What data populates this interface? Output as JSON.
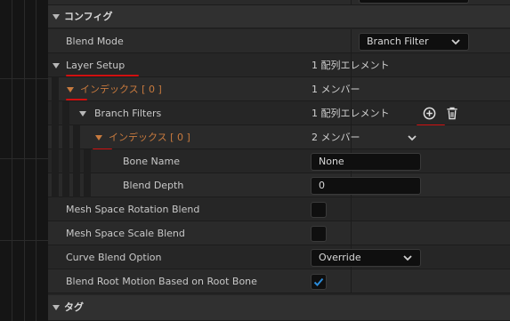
{
  "sections": {
    "config": "コンフィグ",
    "tags": "タグ"
  },
  "rows": {
    "blend_mode": {
      "label": "Blend Mode",
      "value": "Branch Filter"
    },
    "layer_setup": {
      "label": "Layer Setup",
      "value": "1 配列エレメント"
    },
    "index0": {
      "label": "インデックス [ 0 ]",
      "value": "1 メンバー"
    },
    "branch_filters": {
      "label": "Branch Filters",
      "value": "1 配列エレメント"
    },
    "index0_inner": {
      "label": "インデックス [ 0 ]",
      "value": "2 メンバー"
    },
    "bone_name": {
      "label": "Bone Name",
      "value": "None"
    },
    "blend_depth": {
      "label": "Blend Depth",
      "value": "0"
    },
    "mesh_space_rotation": {
      "label": "Mesh Space Rotation Blend",
      "checked": false
    },
    "mesh_space_scale": {
      "label": "Mesh Space Scale Blend",
      "checked": false
    },
    "curve_blend": {
      "label": "Curve Blend Option",
      "value": "Override"
    },
    "blend_root_motion": {
      "label": "Blend Root Motion Based on Root Bone",
      "checked": true
    }
  },
  "icons": {
    "add": "plus-circle-icon",
    "delete": "trash-icon"
  },
  "colors": {
    "accent_orange": "#c87a3e",
    "annotation_red": "#d01010",
    "check_blue": "#2a8ad8"
  }
}
